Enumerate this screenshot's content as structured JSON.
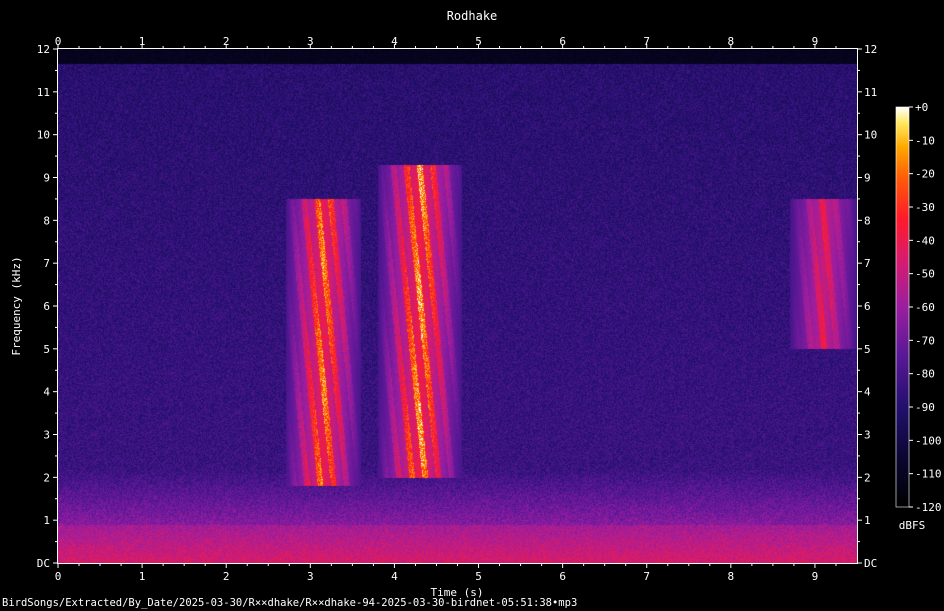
{
  "chart_data": {
    "type": "heatmap",
    "title": "Rodhake",
    "xlabel": "Time (s)",
    "ylabel": "Frequency (kHz)",
    "xlim": [
      0,
      9.5
    ],
    "ylim": [
      0,
      12
    ],
    "x_ticks": [
      "0",
      "1",
      "2",
      "3",
      "4",
      "5",
      "6",
      "7",
      "8",
      "9"
    ],
    "y_ticks": [
      "DC",
      "1",
      "2",
      "3",
      "4",
      "5",
      "6",
      "7",
      "8",
      "9",
      "10",
      "11",
      "12"
    ],
    "colorbar": {
      "label": "dBFS",
      "range": [
        -120,
        0
      ],
      "ticks": [
        "+0",
        "-10",
        "-20",
        "-30",
        "-40",
        "-50",
        "-60",
        "-70",
        "-80",
        "-90",
        "-100",
        "-110",
        "-120"
      ]
    },
    "events": [
      {
        "t_start": 2.7,
        "t_end": 3.6,
        "f_low": 1.8,
        "f_high": 8.5,
        "level_dbfs": -30
      },
      {
        "t_start": 3.8,
        "t_end": 4.8,
        "f_low": 2.0,
        "f_high": 9.3,
        "level_dbfs": -25
      },
      {
        "t_start": 8.7,
        "t_end": 9.5,
        "f_low": 5.0,
        "f_high": 8.5,
        "level_dbfs": -55
      }
    ]
  },
  "footer": "BirdSongs/Extracted/By_Date/2025-03-30/R××dhake/R××dhake-94-2025-03-30-birdnet-05:51:38•mp3"
}
